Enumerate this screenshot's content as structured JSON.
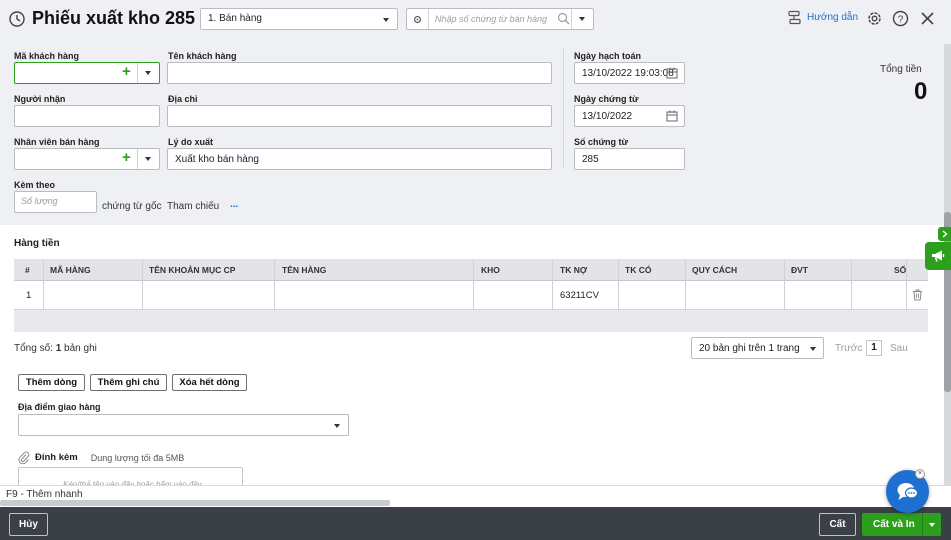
{
  "header": {
    "title": "Phiếu xuất kho 285",
    "type_select": "1. Bán hàng",
    "doc_search_placeholder": "Nhập số chứng từ bán hàng",
    "guide_label": "Hướng dẫn"
  },
  "form": {
    "customer_code_label": "Mã khách hàng",
    "customer_name_label": "Tên khách hàng",
    "receiver_label": "Người nhận",
    "address_label": "Địa chỉ",
    "salesperson_label": "Nhân viên bán hàng",
    "reason_label": "Lý do xuất",
    "reason_value": "Xuất kho bán hàng",
    "attached_label": "Kèm theo",
    "qty_placeholder": "Số lượng",
    "original_docs_label": "chứng từ gốc",
    "reference_label": "Tham chiếu",
    "reference_more": "...",
    "posting_date_label": "Ngày hạch toán",
    "posting_date_value": "13/10/2022 19:03:08",
    "doc_date_label": "Ngày chứng từ",
    "doc_date_value": "13/10/2022",
    "doc_no_label": "Số chứng từ",
    "doc_no_value": "285",
    "total_label": "Tổng tiền",
    "total_value": "0"
  },
  "grid": {
    "section_title": "Hàng tiền",
    "columns": [
      "#",
      "MÃ HÀNG",
      "TÊN KHOẢN MỤC CP",
      "TÊN HÀNG",
      "KHO",
      "TK NỢ",
      "TK CÓ",
      "QUY CÁCH",
      "ĐVT",
      "SỐ"
    ],
    "rows": [
      {
        "no": "1",
        "debit_account": "63211CV"
      }
    ],
    "total_prefix": "Tổng số:",
    "total_count": "1",
    "total_suffix": "bản ghi",
    "page_size": "20 bản ghi trên 1 trang",
    "prev_label": "Trước",
    "page_number": "1",
    "next_label": "Sau"
  },
  "actions": {
    "add_row": "Thêm dòng",
    "add_note": "Thêm ghi chú",
    "delete_all": "Xóa hết dòng"
  },
  "delivery": {
    "label": "Địa điểm giao hàng"
  },
  "attachment": {
    "label": "Đính kèm",
    "size_hint": "Dung lượng tối đa 5MB",
    "drop_hint": "Kéo/thả tệp vào đây hoặc bấm vào đây"
  },
  "hint_bar": {
    "text": "F9 - Thêm nhanh"
  },
  "bottom": {
    "cancel": "Hủy",
    "save": "Cất",
    "save_print": "Cất và In"
  },
  "colors": {
    "accent_green": "#2ca01c",
    "link_blue": "#1e6fd0",
    "bottom_bar": "#3b3f46"
  }
}
